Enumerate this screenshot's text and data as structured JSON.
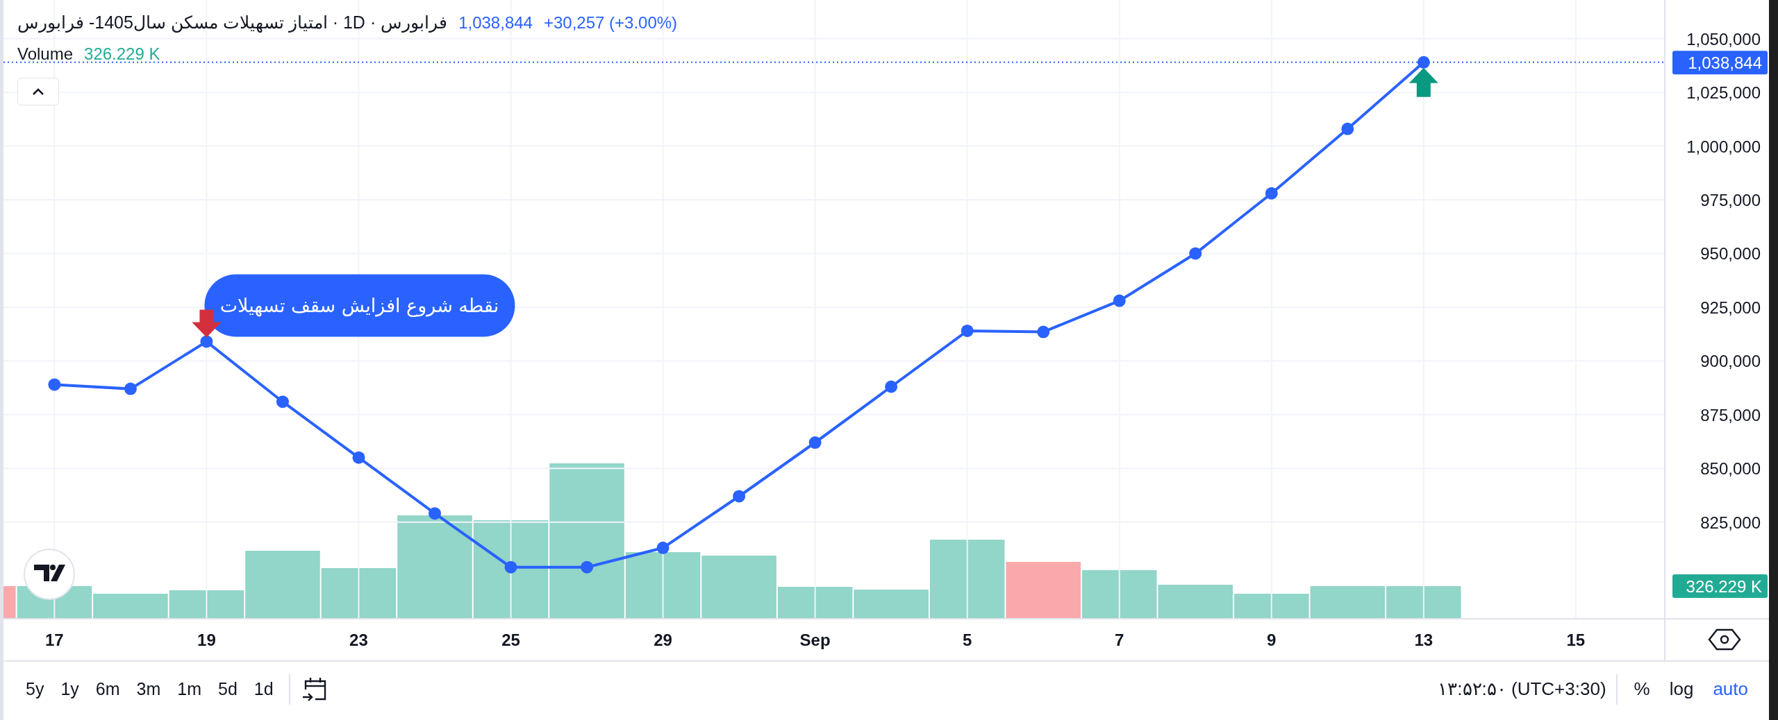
{
  "legend": {
    "title": "فرابورس · 1D · امتیاز تسهیلات مسکن سال1405- فرابورس",
    "price": "1,038,844",
    "change": "+30,257 (+3.00%)",
    "volume_label": "Volume",
    "volume_value": "326.229 K"
  },
  "chart_data": {
    "type": "line",
    "categories": [
      "17",
      null,
      "19",
      null,
      "23",
      null,
      "25",
      null,
      "29",
      null,
      "Sep",
      null,
      "5",
      null,
      "7",
      null,
      "9",
      null,
      "13",
      null,
      "15"
    ],
    "grid": true,
    "series": [
      {
        "color": "#2962ff",
        "marker": "o",
        "values": [
          889000,
          887000,
          909000,
          881000,
          855000,
          829000,
          804000,
          804000,
          813000,
          837000,
          862000,
          888000,
          914000,
          913500,
          928000,
          950000,
          978000,
          1008000,
          1039000,
          null,
          null
        ]
      }
    ],
    "ylim": [
      780000,
      1068000
    ],
    "yticks": [
      {
        "value": 825000,
        "label": "825,000"
      },
      {
        "value": 850000,
        "label": "850,000"
      },
      {
        "value": 875000,
        "label": "875,000"
      },
      {
        "value": 900000,
        "label": "900,000"
      },
      {
        "value": 925000,
        "label": "925,000"
      },
      {
        "value": 950000,
        "label": "950,000"
      },
      {
        "value": 975000,
        "label": "975,000"
      },
      {
        "value": 1000000,
        "label": "1,000,000"
      },
      {
        "value": 1025000,
        "label": "1,025,000"
      },
      {
        "value": 1050000,
        "label": "1,050,000"
      }
    ],
    "annotations": [
      "نقطه شروع افزایش سقف تسهیلات"
    ],
    "ref_lines": [
      {
        "axis": "y",
        "value": 1039000,
        "color": "#2962ff"
      }
    ]
  },
  "signals": [
    {
      "kind": "sell",
      "color": "#d32f3c"
    },
    {
      "kind": "buy",
      "color": "#089981"
    }
  ],
  "volume_bars": [
    {
      "up": false
    },
    {
      "up": true
    },
    {
      "up": true
    },
    {
      "up": true
    },
    {
      "up": true
    },
    {
      "up": true
    },
    {
      "up": true
    },
    {
      "up": true
    },
    {
      "up": true
    },
    {
      "up": true
    },
    {
      "up": true
    },
    {
      "up": true
    },
    {
      "up": true
    },
    {
      "up": true
    },
    {
      "up": false
    },
    {
      "up": true
    },
    {
      "up": true
    },
    {
      "up": true
    },
    {
      "up": true
    },
    {
      "up": true
    }
  ],
  "price_axis": {
    "last_price": "1,038,844",
    "volume": "326.229 K"
  },
  "ranges": [
    {
      "label": "5y"
    },
    {
      "label": "1y"
    },
    {
      "label": "6m"
    },
    {
      "label": "3m"
    },
    {
      "label": "1m"
    },
    {
      "label": "5d"
    },
    {
      "label": "1d"
    }
  ],
  "time": "۱۳:۵۲:۵۰ (UTC+3:30)",
  "scale_options": [
    {
      "label": "%",
      "selected": false
    },
    {
      "label": "log",
      "selected": false
    },
    {
      "label": "auto",
      "selected": true
    }
  ]
}
